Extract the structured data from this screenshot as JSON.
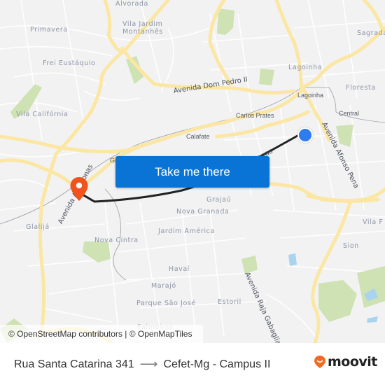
{
  "map": {
    "neighborhoods": [
      {
        "id": "alvorada",
        "label": "Alvorada"
      },
      {
        "id": "vila-jardim-montanhes-1",
        "label": "Vila Jardim"
      },
      {
        "id": "vila-jardim-montanhes-2",
        "label": "Montanhês"
      },
      {
        "id": "primavera",
        "label": "Primavera"
      },
      {
        "id": "frei-eustaquio",
        "label": "Frei Eustáquio"
      },
      {
        "id": "vila-california",
        "label": "Vila Califórnia"
      },
      {
        "id": "sagrada",
        "label": "Sagrada"
      },
      {
        "id": "lagoinha",
        "label": "Lagoinha"
      },
      {
        "id": "floresta",
        "label": "Floresta"
      },
      {
        "id": "glalija",
        "label": "Glalijá"
      },
      {
        "id": "nova-cintra",
        "label": "Nova Cintra"
      },
      {
        "id": "grajau",
        "label": "Grajaú"
      },
      {
        "id": "nova-granada",
        "label": "Nova Granada"
      },
      {
        "id": "jardim-america",
        "label": "Jardim América"
      },
      {
        "id": "vila-f",
        "label": "Vila F"
      },
      {
        "id": "sion",
        "label": "Sion"
      },
      {
        "id": "havai",
        "label": "Havaí"
      },
      {
        "id": "marajo",
        "label": "Marajó"
      },
      {
        "id": "parque-sao-jose",
        "label": "Parque São José"
      },
      {
        "id": "estoril",
        "label": "Estoril"
      },
      {
        "id": "palmeiras",
        "label": "Palmeiras"
      }
    ],
    "places": [
      {
        "id": "lagoinha-station",
        "label": "Lagoinha"
      },
      {
        "id": "carlos-prates",
        "label": "Carlos Prates"
      },
      {
        "id": "central",
        "label": "Central"
      },
      {
        "id": "calafate",
        "label": "Calafate"
      },
      {
        "id": "ga",
        "label": "Ga"
      }
    ],
    "streets": [
      {
        "id": "avenida-dom-pedro-ii",
        "label": "Avenida Dom Pedro II"
      },
      {
        "id": "avenida-afonso-pena",
        "label": "Avenida Afonso Pena"
      },
      {
        "id": "avenida-amazonas",
        "label": "Avenida Amazonas"
      },
      {
        "id": "avenida-amazonas-2",
        "label": "onas"
      },
      {
        "id": "avenida-raja-gabaglia",
        "label": "Avenida Raja Gabaglia"
      }
    ],
    "colors": {
      "background": "#f2f2f3",
      "road_major": "#fbe7a3",
      "road_minor": "#ffffff",
      "park": "#cfe2b4",
      "water": "#a9d3ef",
      "route": "#222222",
      "origin": "#2f7bf0",
      "destination": "#f0531c"
    },
    "attribution": "© OpenStreetMap contributors | © OpenMapTiles"
  },
  "cta": {
    "label": "Take me there"
  },
  "footer": {
    "origin": "Rua Santa Catarina 341",
    "arrow": "⟶",
    "destination": "Cefet-Mg - Campus II",
    "brand": "moovit",
    "brand_color": "#f26b21"
  }
}
